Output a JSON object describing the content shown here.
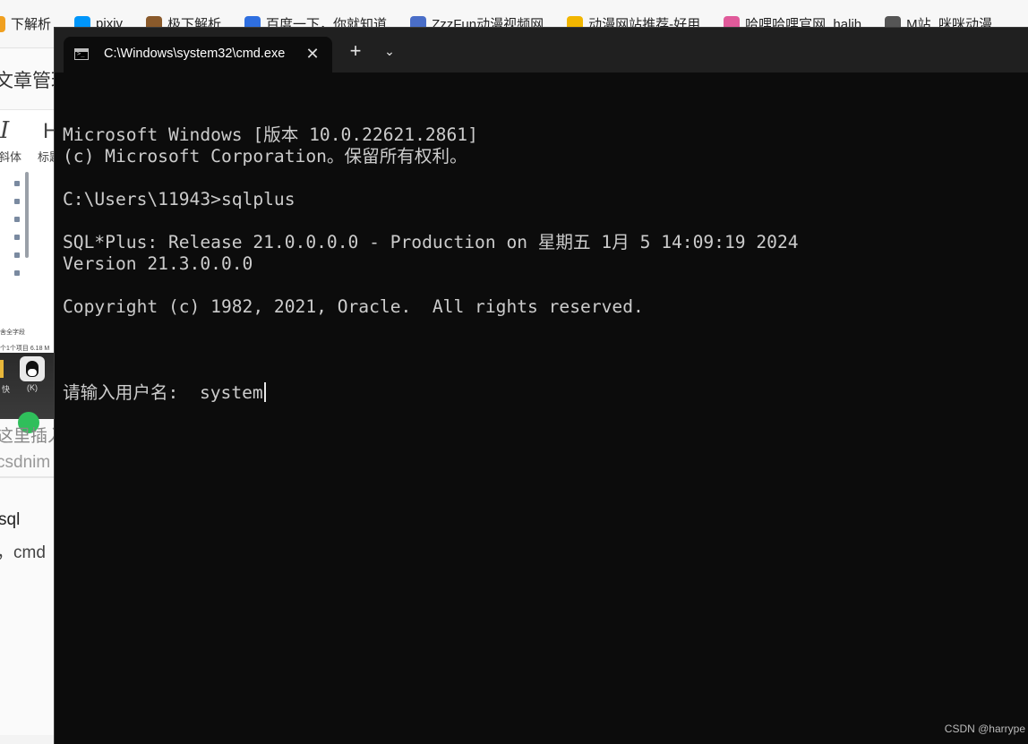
{
  "bookmarks": [
    {
      "label": "下解析",
      "icon": "parse-icon",
      "color": "#f0a020"
    },
    {
      "label": "pixiv",
      "icon": "pixiv-icon",
      "color": "#0096fa"
    },
    {
      "label": "极下解析",
      "icon": "parse-icon",
      "color": "#8a5a2b"
    },
    {
      "label": "百度一下，你就知道",
      "icon": "baidu-icon",
      "color": "#2f6fe0"
    },
    {
      "label": "ZzzFun动漫视频网",
      "icon": "zzzfun-icon",
      "color": "#4a6ec8"
    },
    {
      "label": "动漫网站推荐-好用",
      "icon": "star-icon",
      "color": "#f2b600"
    },
    {
      "label": "哈哩哈哩官网_halih",
      "icon": "halihali-icon",
      "color": "#e05a9a"
    },
    {
      "label": "M站_咪咪动漫",
      "icon": "mstation-icon",
      "color": "#555555"
    }
  ],
  "editor": {
    "title": "文章管理",
    "italic_glyph": "I",
    "heading_glyph": "H",
    "italic_label": "斜体",
    "heading_label": "标题",
    "thumb_text_1": "舍全字段",
    "thumb_text_2": "个1个项目 6.18 M",
    "desktop_label_1": "快",
    "desktop_label_2": "(K)",
    "insert_text": "这里插入",
    "url_text": "csdnim",
    "line_sql": "sql",
    "line_cmd": "，cmd"
  },
  "terminal": {
    "tab_title": "C:\\Windows\\system32\\cmd.exe",
    "new_tab_glyph": "+",
    "close_glyph": "✕",
    "dropdown_glyph": "⌄",
    "lines": [
      "Microsoft Windows [版本 10.0.22621.2861]",
      "(c) Microsoft Corporation。保留所有权利。",
      "",
      "C:\\Users\\11943>sqlplus",
      "",
      "SQL*Plus: Release 21.0.0.0.0 - Production on 星期五 1月 5 14:09:19 2024",
      "Version 21.3.0.0.0",
      "",
      "Copyright (c) 1982, 2021, Oracle.  All rights reserved.",
      ""
    ],
    "prompt": "请输入用户名:  ",
    "input_value": "system",
    "colors": {
      "background": "#0c0c0c",
      "text": "#cccccc",
      "tabbar": "#202020"
    }
  },
  "watermark": "CSDN @harrype"
}
